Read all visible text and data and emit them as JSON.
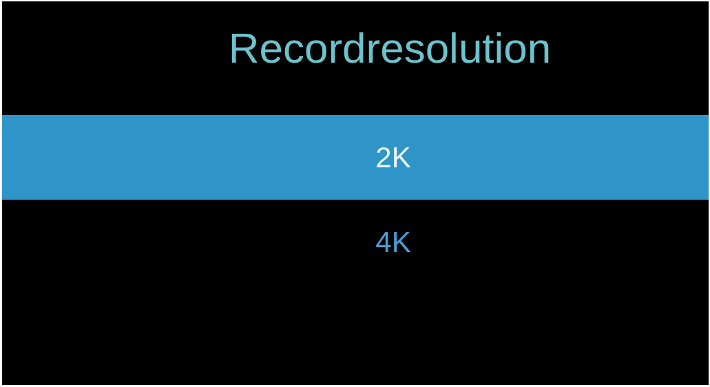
{
  "title": "Recordresolution",
  "options": [
    {
      "label": "2K",
      "selected": true
    },
    {
      "label": "4K",
      "selected": false
    }
  ]
}
